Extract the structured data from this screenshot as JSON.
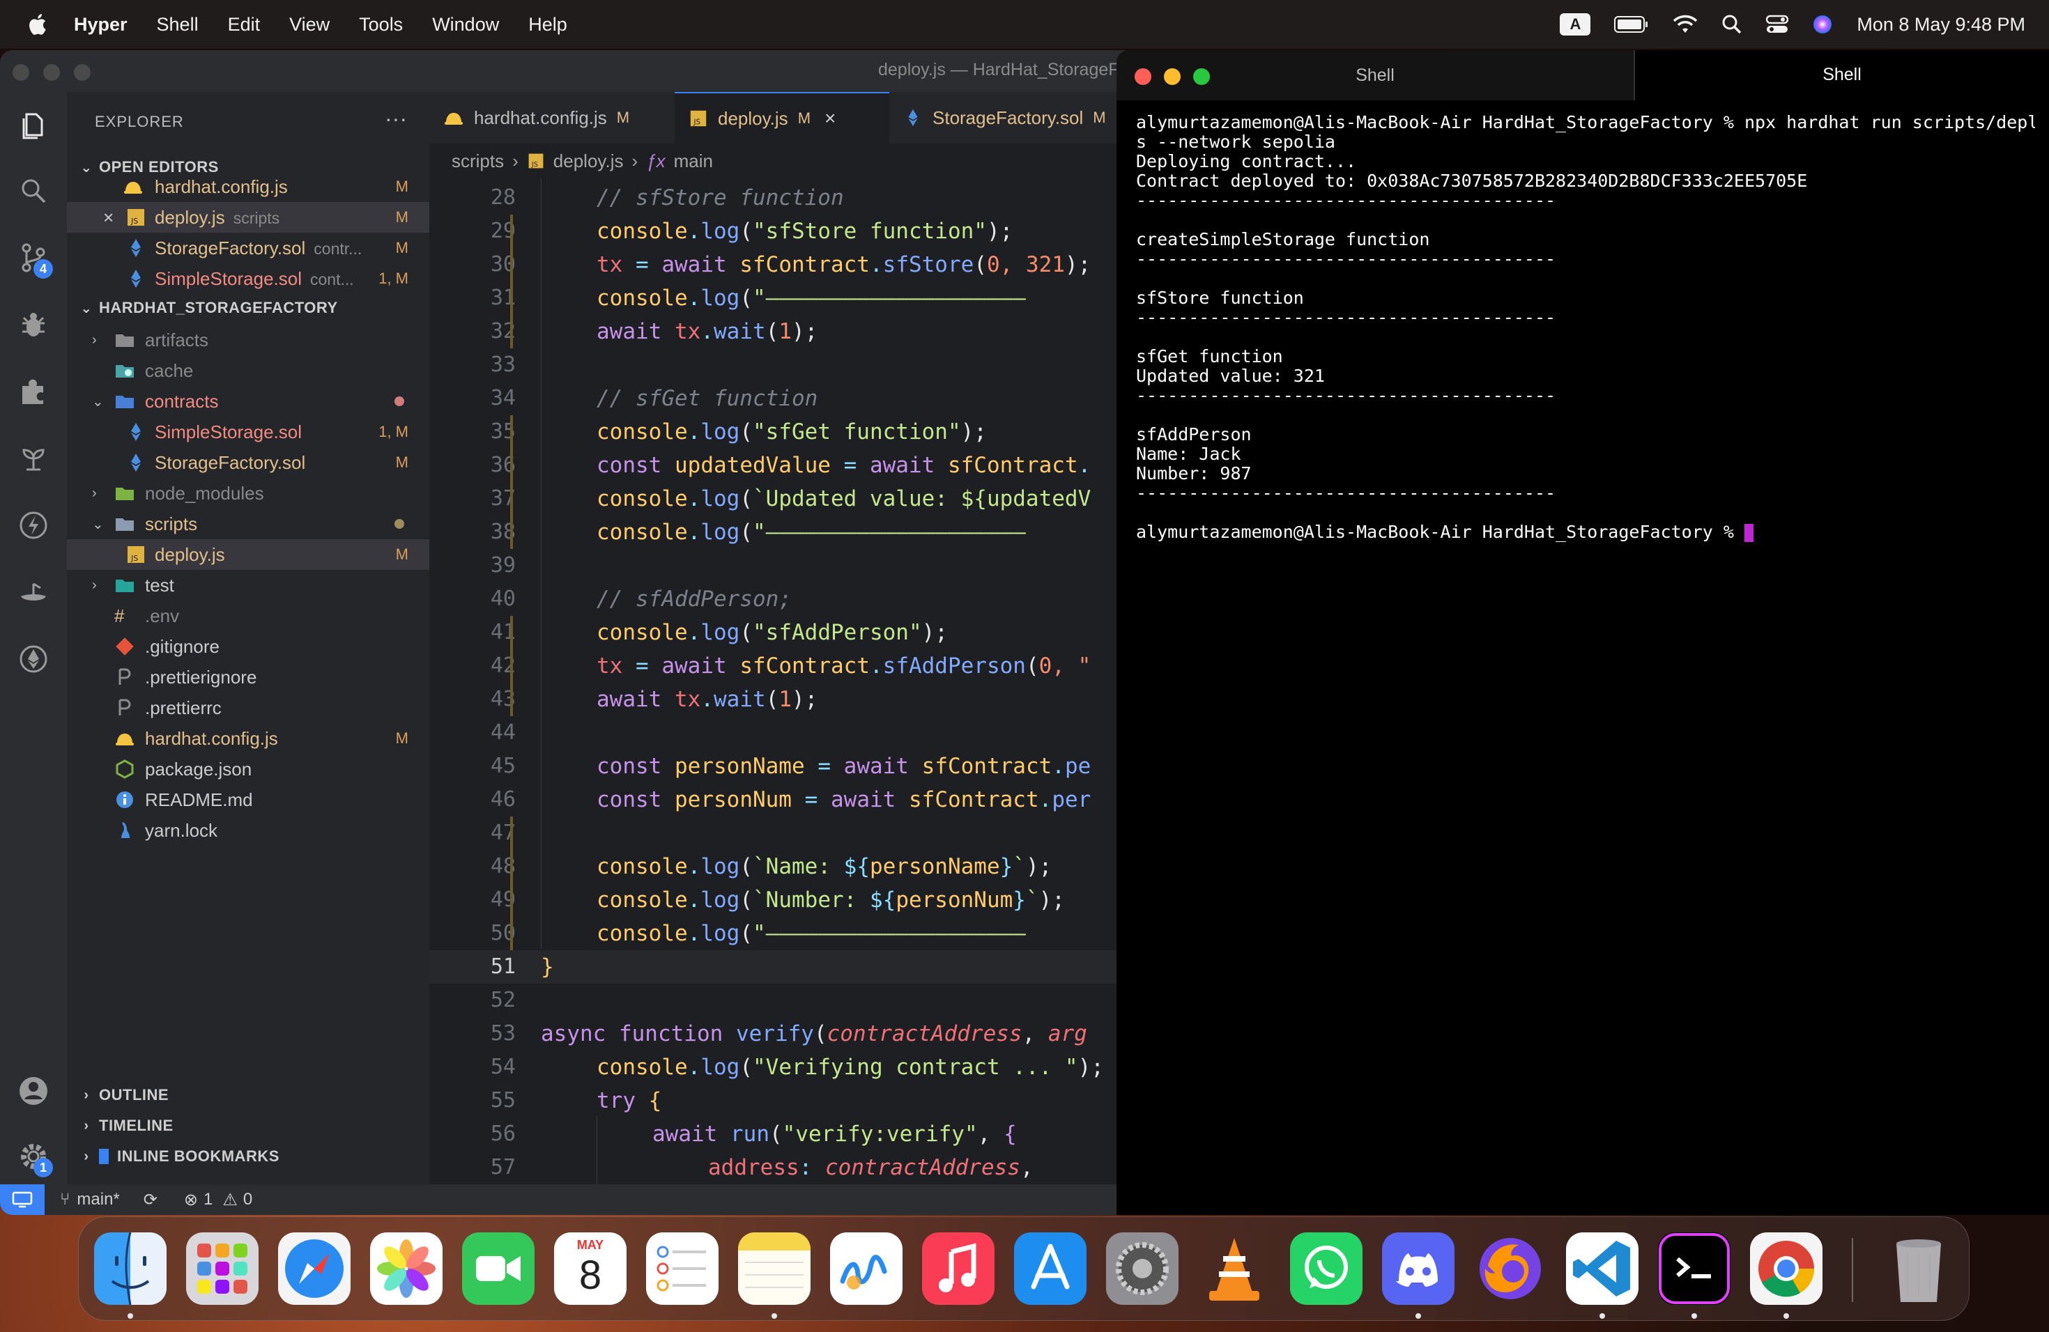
{
  "menubar": {
    "app_name": "Hyper",
    "items": [
      "Shell",
      "Edit",
      "View",
      "Tools",
      "Window",
      "Help"
    ],
    "input_source": "A",
    "datetime": "Mon 8 May  9:48 PM"
  },
  "vscode": {
    "window_title": "deploy.js — HardHat_StorageF",
    "explorer": {
      "header": "EXPLORER",
      "more": "···",
      "open_editors_label": "OPEN EDITORS",
      "open_editors": [
        {
          "name": "hardhat.config.js",
          "desc": "",
          "status": "M"
        },
        {
          "name": "deploy.js",
          "desc": "scripts",
          "status": "M"
        },
        {
          "name": "StorageFactory.sol",
          "desc": "contr...",
          "status": "M"
        },
        {
          "name": "SimpleStorage.sol",
          "desc": "cont...",
          "status": "1, M"
        }
      ],
      "project_label": "HARDHAT_STORAGEFACTORY",
      "tree": [
        {
          "name": "artifacts",
          "status": ""
        },
        {
          "name": "cache",
          "status": ""
        },
        {
          "name": "contracts",
          "status": ""
        },
        {
          "name": "SimpleStorage.sol",
          "status": "1, M"
        },
        {
          "name": "StorageFactory.sol",
          "status": "M"
        },
        {
          "name": "node_modules",
          "status": ""
        },
        {
          "name": "scripts",
          "status": ""
        },
        {
          "name": "deploy.js",
          "status": "M"
        },
        {
          "name": "test",
          "status": ""
        },
        {
          "name": ".env",
          "status": ""
        },
        {
          "name": ".gitignore",
          "status": ""
        },
        {
          "name": ".prettierignore",
          "status": ""
        },
        {
          "name": ".prettierrc",
          "status": ""
        },
        {
          "name": "hardhat.config.js",
          "status": "M"
        },
        {
          "name": "package.json",
          "status": ""
        },
        {
          "name": "README.md",
          "status": ""
        },
        {
          "name": "yarn.lock",
          "status": ""
        }
      ],
      "outline_label": "OUTLINE",
      "timeline_label": "TIMELINE",
      "bookmarks_label": "INLINE BOOKMARKS"
    },
    "tabs": [
      {
        "name": "hardhat.config.js",
        "status": "M"
      },
      {
        "name": "deploy.js",
        "status": "M"
      },
      {
        "name": "StorageFactory.sol",
        "status": "M"
      }
    ],
    "breadcrumb": {
      "folder": "scripts",
      "file": "deploy.js",
      "symbol": "main"
    },
    "line_numbers": [
      "28",
      "29",
      "30",
      "31",
      "32",
      "33",
      "34",
      "35",
      "36",
      "37",
      "38",
      "39",
      "40",
      "41",
      "42",
      "43",
      "44",
      "45",
      "46",
      "47",
      "48",
      "49",
      "50",
      "51",
      "52",
      "53",
      "54",
      "55",
      "56",
      "57"
    ],
    "code": {
      "l28_comment": "// sfStore function",
      "l29_str": "\"sfStore function\"",
      "l30_args": "0, 321",
      "l31_str": "\"————————————————————",
      "l32_num": "1",
      "l34_comment": "// sfGet function",
      "l35_str": "\"sfGet function\"",
      "l36_var": "updatedValue",
      "l37_tpl": "`Updated value: ${updatedV",
      "l38_str": "\"————————————————————",
      "l40_comment": "// sfAddPerson;",
      "l41_str": "\"sfAddPerson\"",
      "l42_args": "0, \"",
      "l43_num": "1",
      "l45_var": "personName",
      "l45_tail": "pe",
      "l46_var": "personNum",
      "l46_tail": "per",
      "l48_tpl_a": "`Name: ",
      "l48_tpl_var": "personName",
      "l49_tpl_a": "`Number: ",
      "l49_tpl_var": "personNum",
      "l50_str": "\"————————————————————",
      "l53_fn": "verify",
      "l53_p1": "contractAddress",
      "l53_p2": "arg",
      "l54_str": "\"Verifying contract ... \"",
      "l56_str": "\"verify:verify\"",
      "l57_key": "address",
      "l57_val": "contractAddress"
    },
    "statusbar": {
      "branch": "main*",
      "errors": "1",
      "warnings": "0"
    },
    "badges": {
      "source_control": "4",
      "settings": "1"
    }
  },
  "hyper": {
    "tabs": [
      "Shell",
      "Shell"
    ],
    "lines": [
      "alymurtazamemon@Alis-MacBook-Air HardHat_StorageFactory % npx hardhat run scripts/deploy.j",
      "s --network sepolia",
      "Deploying contract...",
      "Contract deployed to: 0x038Ac730758572B282340D2B8DCF333c2EE5705E",
      "----------------------------------------",
      "",
      "createSimpleStorage function",
      "----------------------------------------",
      "",
      "sfStore function",
      "----------------------------------------",
      "",
      "sfGet function",
      "Updated value: 321",
      "----------------------------------------",
      "",
      "sfAddPerson",
      "Name: Jack",
      "Number: 987",
      "----------------------------------------",
      "",
      "alymurtazamemon@Alis-MacBook-Air HardHat_StorageFactory % "
    ]
  },
  "dock": {
    "apps": [
      "finder-icon",
      "launchpad-icon",
      "safari-icon",
      "photos-icon",
      "facetime-icon",
      "calendar-icon",
      "reminders-icon",
      "notes-icon",
      "freeform-icon",
      "music-icon",
      "app-store-icon",
      "system-settings-icon",
      "vlc-icon",
      "whatsapp-icon",
      "discord-icon",
      "firefox-icon",
      "vscode-icon",
      "hyper-icon",
      "chrome-icon",
      "trash-icon"
    ],
    "calendar_month": "MAY",
    "calendar_day": "8"
  },
  "colors": {
    "accent": "#3b82f6",
    "modified": "#e2c08d",
    "cursor": "#c026d3"
  }
}
